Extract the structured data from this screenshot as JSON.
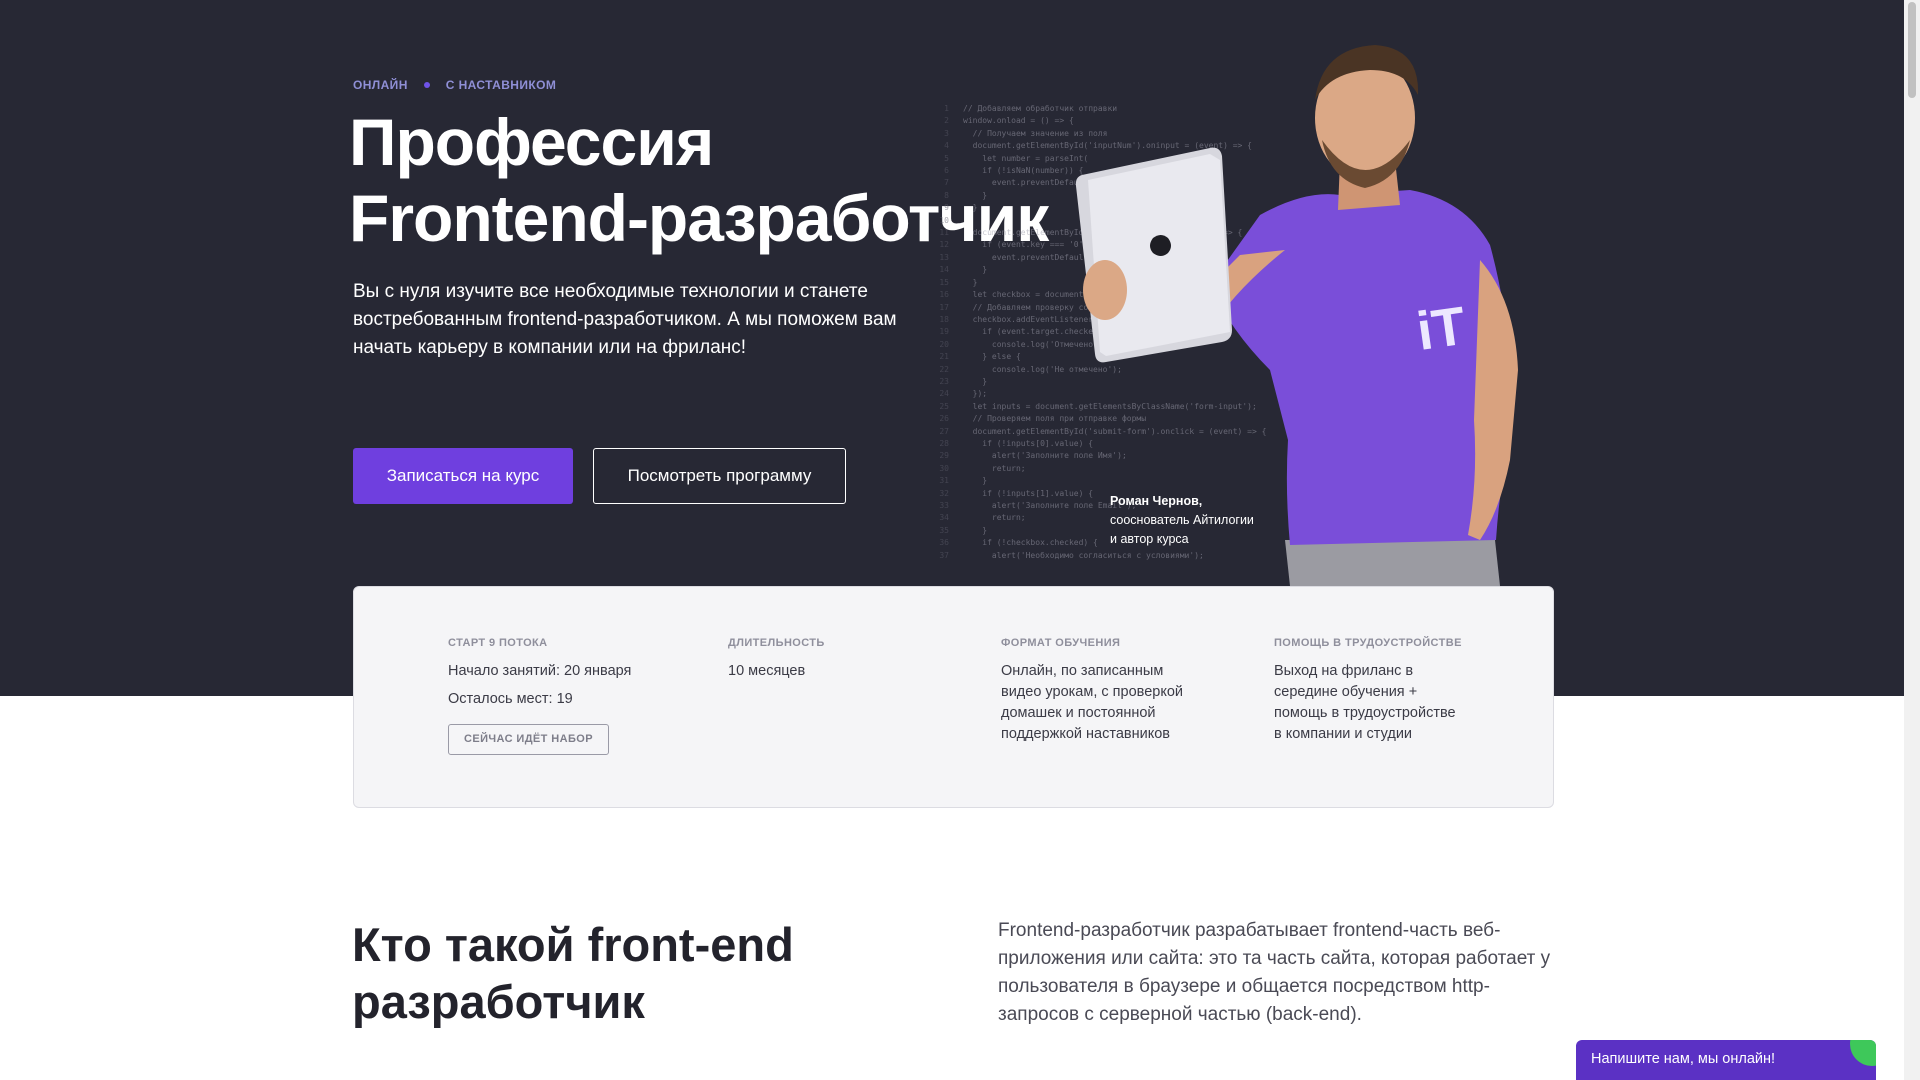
{
  "hero": {
    "tags": [
      "ОНЛАЙН",
      "С НАСТАВНИКОМ"
    ],
    "title_line1": "Профессия",
    "title_line2": "Frontend-разработчик",
    "description": "Вы с нуля изучите все необходимые технологии и станете востребованным frontend-разработчиком. А мы поможем вам начать карьеру в компании или на фриланс!",
    "primary_button": "Записаться на курс",
    "secondary_button": "Посмотреть программу",
    "author_name": "Роман Чернов,",
    "author_role_line1": "сооснователь Айтилогии",
    "author_role_line2": "и автор курса",
    "shirt_logo": "iT"
  },
  "code_lines": [
    {
      "n": "1",
      "t": "// Добавляем обработчик отправки"
    },
    {
      "n": "2",
      "t": "window.onload = () => {"
    },
    {
      "n": "3",
      "t": "  // Получаем значение из поля"
    },
    {
      "n": "4",
      "t": "  document.getElementById('inputNum').oninput = (event) => {"
    },
    {
      "n": "5",
      "t": "    let number = parseInt("
    },
    {
      "n": "6",
      "t": "    if (!isNaN(number)) {"
    },
    {
      "n": "7",
      "t": "      event.preventDefault();"
    },
    {
      "n": "8",
      "t": "    }"
    },
    {
      "n": "9",
      "t": "  }"
    },
    {
      "n": "10",
      "t": ""
    },
    {
      "n": "11",
      "t": "  document.getElementById('name').onkeydown = (event) => {"
    },
    {
      "n": "12",
      "t": "    if (event.key === '0') {"
    },
    {
      "n": "13",
      "t": "      event.preventDefault();"
    },
    {
      "n": "14",
      "t": "    }"
    },
    {
      "n": "15",
      "t": "  }"
    },
    {
      "n": "16",
      "t": "  let checkbox = document.getElementById('agree');"
    },
    {
      "n": "17",
      "t": "  // Добавляем проверку согласия"
    },
    {
      "n": "18",
      "t": "  checkbox.addEventListener('change', () => {"
    },
    {
      "n": "19",
      "t": "    if (event.target.checked) {"
    },
    {
      "n": "20",
      "t": "      console.log('Отмечено');"
    },
    {
      "n": "21",
      "t": "    } else {"
    },
    {
      "n": "22",
      "t": "      console.log('Не отмечено');"
    },
    {
      "n": "23",
      "t": "    }"
    },
    {
      "n": "24",
      "t": "  });"
    },
    {
      "n": "25",
      "t": "  let inputs = document.getElementsByClassName('form-input');"
    },
    {
      "n": "26",
      "t": "  // Проверяем поля при отправке формы"
    },
    {
      "n": "27",
      "t": "  document.getElementById('submit-form').onclick = (event) => {"
    },
    {
      "n": "28",
      "t": "    if (!inputs[0].value) {"
    },
    {
      "n": "29",
      "t": "      alert('Заполните поле Имя');"
    },
    {
      "n": "30",
      "t": "      return;"
    },
    {
      "n": "31",
      "t": "    }"
    },
    {
      "n": "32",
      "t": "    if (!inputs[1].value) {"
    },
    {
      "n": "33",
      "t": "      alert('Заполните поле Email');"
    },
    {
      "n": "34",
      "t": "      return;"
    },
    {
      "n": "35",
      "t": "    }"
    },
    {
      "n": "36",
      "t": "    if (!checkbox.checked) {"
    },
    {
      "n": "37",
      "t": "      alert('Необходимо согласиться с условиями');"
    }
  ],
  "info": {
    "start": {
      "label": "СТАРТ 9 ПОТОКА",
      "line1": "Начало занятий: 20 января",
      "line2": "Осталось мест: 19",
      "badge": "СЕЙЧАС ИДЁТ НАБОР"
    },
    "duration": {
      "label": "ДЛИТЕЛЬНОСТЬ",
      "text": "10 месяцев"
    },
    "format": {
      "label": "ФОРМАТ ОБУЧЕНИЯ",
      "lines": [
        "Онлайн, по записанным",
        "видео урокам, с проверкой",
        "домашек и постоянной",
        "поддержкой наставников"
      ]
    },
    "career": {
      "label": "ПОМОЩЬ В ТРУДОУСТРОЙСТВЕ",
      "lines": [
        "Выход на фриланс в",
        "середине обучения +",
        "помощь в трудоустройстве",
        "в компании и студии"
      ]
    }
  },
  "section": {
    "title_line1": "Кто такой front-end",
    "title_line2": "разработчик",
    "text": "Frontend-разработчик разрабатывает frontend-часть веб-приложения или сайта: это та часть сайта, которая работает у пользователя в браузере и общается посредством http-запросов с серверной частью (back-end)."
  },
  "chat": {
    "label": "Напишите нам, мы онлайн!"
  },
  "colors": {
    "hero_bg": "#272834",
    "accent": "#6f3fdf",
    "tag": "#8f8fd6",
    "card_bg": "#f5f5f7",
    "chat_bg": "#5b31c4",
    "chat_online": "#3ec85a"
  }
}
